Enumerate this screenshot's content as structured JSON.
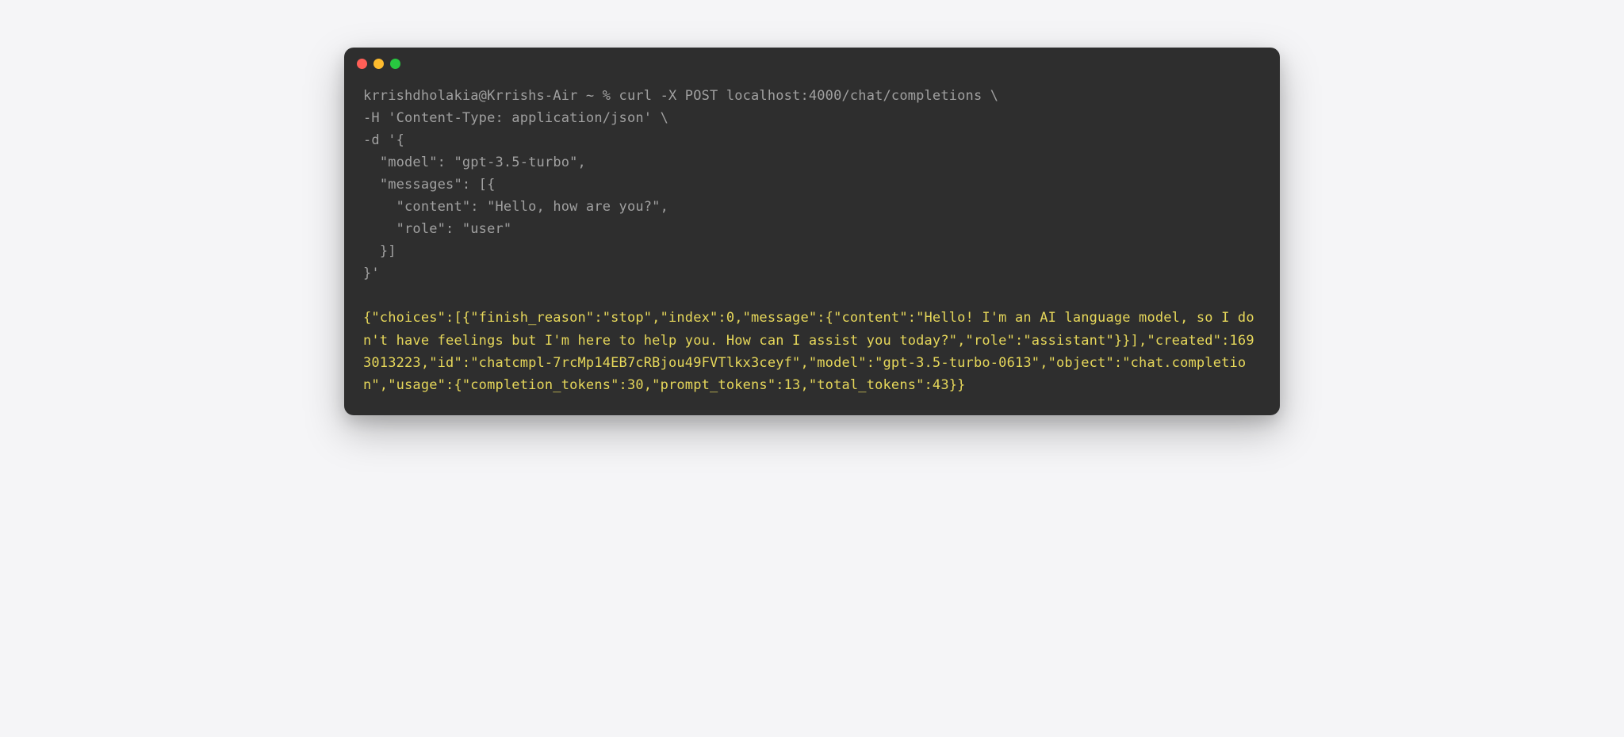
{
  "terminal": {
    "colors": {
      "background": "#2e2e2e",
      "commandText": "#a0a0a0",
      "outputText": "#e6d75a",
      "dotRed": "#ff5f57",
      "dotYellow": "#febc2e",
      "dotGreen": "#28c840"
    },
    "command": "krrishdholakia@Krrishs-Air ~ % curl -X POST localhost:4000/chat/completions \\\n-H 'Content-Type: application/json' \\\n-d '{\n  \"model\": \"gpt-3.5-turbo\",\n  \"messages\": [{\n    \"content\": \"Hello, how are you?\",\n    \"role\": \"user\"\n  }]\n}'",
    "output": "{\"choices\":[{\"finish_reason\":\"stop\",\"index\":0,\"message\":{\"content\":\"Hello! I'm an AI language model, so I don't have feelings but I'm here to help you. How can I assist you today?\",\"role\":\"assistant\"}}],\"created\":1693013223,\"id\":\"chatcmpl-7rcMp14EB7cRBjou49FVTlkx3ceyf\",\"model\":\"gpt-3.5-turbo-0613\",\"object\":\"chat.completion\",\"usage\":{\"completion_tokens\":30,\"prompt_tokens\":13,\"total_tokens\":43}}"
  }
}
